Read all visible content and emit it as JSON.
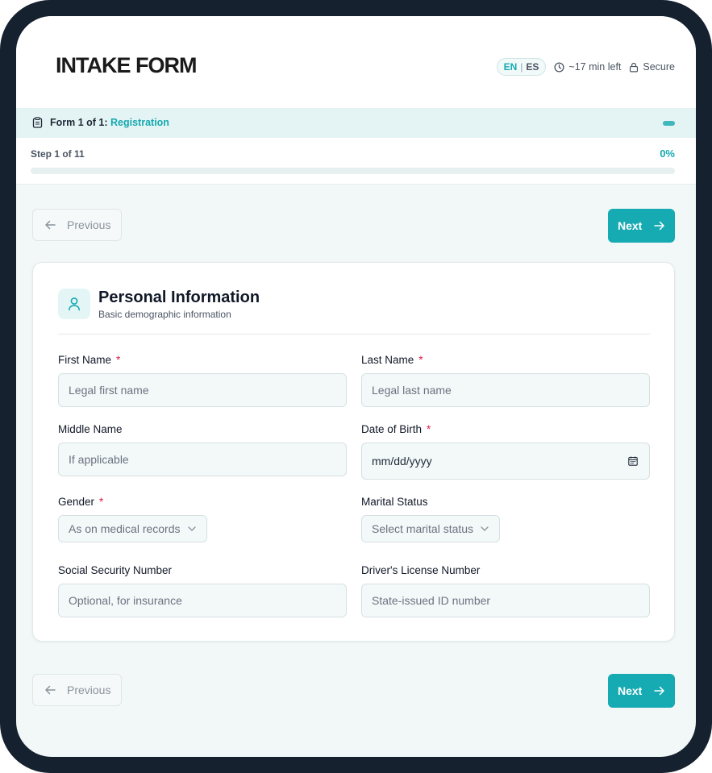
{
  "header": {
    "brand": "INTAKE FORM",
    "lang_en": "EN",
    "lang_sep": "|",
    "lang_es": "ES",
    "time_left": "~17 min left",
    "secure": "Secure"
  },
  "form_bar": {
    "prefix": "Form 1 of 1: ",
    "form_name": "Registration"
  },
  "progress": {
    "step_text": "Step 1 of 11",
    "percent_text": "0%",
    "fraction": 0
  },
  "nav": {
    "previous": "Previous",
    "next": "Next"
  },
  "section": {
    "title": "Personal Information",
    "subtitle": "Basic demographic information",
    "icon": "user-icon"
  },
  "fields": {
    "first_name": {
      "label": "First Name",
      "required": "*",
      "placeholder": "Legal first name"
    },
    "last_name": {
      "label": "Last Name",
      "required": "*",
      "placeholder": "Legal last name"
    },
    "middle_name": {
      "label": "Middle Name",
      "placeholder": "If applicable"
    },
    "dob": {
      "label": "Date of Birth",
      "required": "*",
      "value": "mm/dd/yyyy"
    },
    "gender": {
      "label": "Gender",
      "required": "*",
      "value": "As on medical records"
    },
    "marital_status": {
      "label": "Marital Status",
      "value": "Select marital status"
    },
    "ssn": {
      "label": "Social Security Number",
      "placeholder": "Optional, for insurance"
    },
    "drivers_license": {
      "label": "Driver's License Number",
      "placeholder": "State-issued ID number"
    }
  },
  "colors": {
    "accent": "#16aab2",
    "frame": "#16212f",
    "required": "#e11d48"
  }
}
